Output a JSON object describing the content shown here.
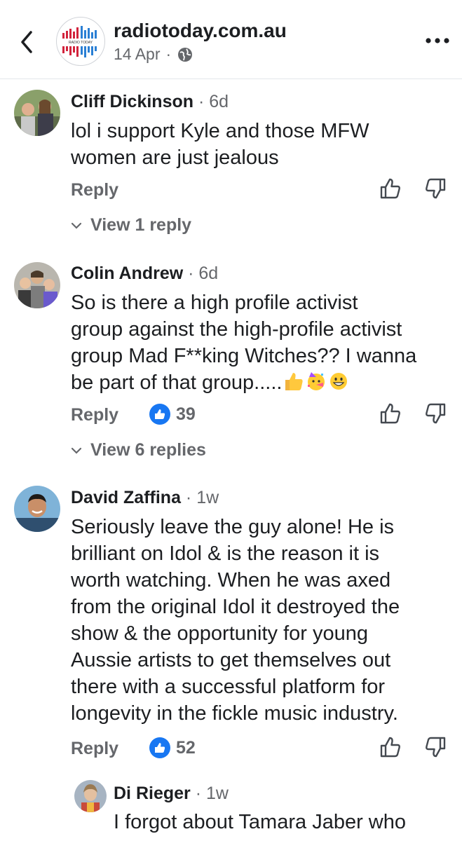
{
  "header": {
    "page_name": "radiotoday.com.au",
    "date": "14 Apr",
    "separator": "·",
    "logo_text": "RADIO TODAY",
    "colors": {
      "logo_red": "#d2233c",
      "logo_blue": "#2a7fd4"
    },
    "icons": [
      "back-icon",
      "globe-icon",
      "more-icon"
    ]
  },
  "comments": [
    {
      "author": "Cliff Dickinson",
      "age": "6d",
      "text_lines": [
        "lol i support Kyle and those MFW",
        "women are just jealous"
      ],
      "reply_label": "Reply",
      "view_replies": "View 1 reply"
    },
    {
      "author": "Colin Andrew",
      "age": "6d",
      "text_lines": [
        "So is there a high profile activist",
        "group against the high-profile activist",
        "group Mad F**king Witches?? I wanna",
        "be part of that group....."
      ],
      "emojis": [
        "thumbs-up",
        "party-face",
        "grinning-face"
      ],
      "reply_label": "Reply",
      "likes": "39",
      "view_replies": "View 6 replies"
    },
    {
      "author": "David Zaffina",
      "age": "1w",
      "text_lines": [
        "Seriously leave the guy alone! He is",
        "brilliant on Idol & is the reason it is",
        "worth watching. When he was axed",
        "from the original Idol it destroyed the",
        "show & the opportunity for young",
        "Aussie artists to get themselves out",
        "there with a successful platform for",
        "longevity in the fickle music industry."
      ],
      "reply_label": "Reply",
      "likes": "52"
    },
    {
      "author": "Di Rieger",
      "age": "1w",
      "text_lines": [
        "I forgot about Tamara Jaber who"
      ]
    }
  ],
  "colors": {
    "like_blue": "#1877f2",
    "muted_text": "#65676b",
    "text": "#1c1e21"
  }
}
